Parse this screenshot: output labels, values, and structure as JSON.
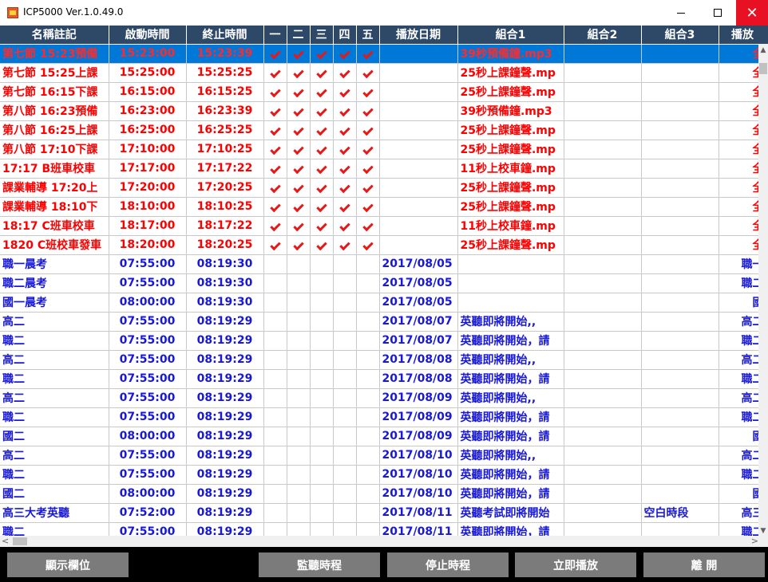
{
  "window": {
    "title": "ICP5000 Ver.1.0.49.0",
    "minimize": "—",
    "maximize": "□",
    "close": "✕"
  },
  "columns": [
    "名稱註記",
    "啟動時間",
    "終止時間",
    "一",
    "二",
    "三",
    "四",
    "五",
    "播放日期",
    "組合1",
    "組合2",
    "組合3",
    "播放"
  ],
  "rows": [
    {
      "name": "第七節 15:23預備",
      "start": "15:23:00",
      "end": "15:23:39",
      "days": [
        true,
        true,
        true,
        true,
        true
      ],
      "date": "",
      "combo1": "39秒預備鐘.mp3",
      "combo2": "",
      "combo3": "",
      "play": "全",
      "color": "red",
      "selected": true
    },
    {
      "name": "第七節 15:25上課",
      "start": "15:25:00",
      "end": "15:25:25",
      "days": [
        true,
        true,
        true,
        true,
        true
      ],
      "date": "",
      "combo1": "25秒上課鐘聲.mp",
      "combo2": "",
      "combo3": "",
      "play": "全",
      "color": "red",
      "selected": false
    },
    {
      "name": "第七節 16:15下課",
      "start": "16:15:00",
      "end": "16:15:25",
      "days": [
        true,
        true,
        true,
        true,
        true
      ],
      "date": "",
      "combo1": "25秒上課鐘聲.mp",
      "combo2": "",
      "combo3": "",
      "play": "全",
      "color": "red",
      "selected": false
    },
    {
      "name": "第八節 16:23預備",
      "start": "16:23:00",
      "end": "16:23:39",
      "days": [
        true,
        true,
        true,
        true,
        true
      ],
      "date": "",
      "combo1": "39秒預備鐘.mp3",
      "combo2": "",
      "combo3": "",
      "play": "全",
      "color": "red",
      "selected": false
    },
    {
      "name": "第八節 16:25上課",
      "start": "16:25:00",
      "end": "16:25:25",
      "days": [
        true,
        true,
        true,
        true,
        true
      ],
      "date": "",
      "combo1": "25秒上課鐘聲.mp",
      "combo2": "",
      "combo3": "",
      "play": "全",
      "color": "red",
      "selected": false
    },
    {
      "name": "第八節 17:10下課",
      "start": "17:10:00",
      "end": "17:10:25",
      "days": [
        true,
        true,
        true,
        true,
        true
      ],
      "date": "",
      "combo1": "25秒上課鐘聲.mp",
      "combo2": "",
      "combo3": "",
      "play": "全",
      "color": "red",
      "selected": false
    },
    {
      "name": "17:17 B班車校車",
      "start": "17:17:00",
      "end": "17:17:22",
      "days": [
        true,
        true,
        true,
        true,
        true
      ],
      "date": "",
      "combo1": "11秒上校車鐘.mp",
      "combo2": "",
      "combo3": "",
      "play": "全",
      "color": "red",
      "selected": false
    },
    {
      "name": "課業輔導 17:20上",
      "start": "17:20:00",
      "end": "17:20:25",
      "days": [
        true,
        true,
        true,
        true,
        true
      ],
      "date": "",
      "combo1": "25秒上課鐘聲.mp",
      "combo2": "",
      "combo3": "",
      "play": "全",
      "color": "red",
      "selected": false
    },
    {
      "name": "課業輔導 18:10下",
      "start": "18:10:00",
      "end": "18:10:25",
      "days": [
        true,
        true,
        true,
        true,
        true
      ],
      "date": "",
      "combo1": "25秒上課鐘聲.mp",
      "combo2": "",
      "combo3": "",
      "play": "全",
      "color": "red",
      "selected": false
    },
    {
      "name": "18:17 C班車校車",
      "start": "18:17:00",
      "end": "18:17:22",
      "days": [
        true,
        true,
        true,
        true,
        true
      ],
      "date": "",
      "combo1": "11秒上校車鐘.mp",
      "combo2": "",
      "combo3": "",
      "play": "全",
      "color": "red",
      "selected": false
    },
    {
      "name": "1820 C班校車發車",
      "start": "18:20:00",
      "end": "18:20:25",
      "days": [
        true,
        true,
        true,
        true,
        true
      ],
      "date": "",
      "combo1": "25秒上課鐘聲.mp",
      "combo2": "",
      "combo3": "",
      "play": "全",
      "color": "red",
      "selected": false
    },
    {
      "name": "職一晨考",
      "start": "07:55:00",
      "end": "08:19:30",
      "days": [
        false,
        false,
        false,
        false,
        false
      ],
      "date": "2017/08/05",
      "combo1": "",
      "combo2": "",
      "combo3": "",
      "play": "職一",
      "color": "blue",
      "selected": false
    },
    {
      "name": "職二晨考",
      "start": "07:55:00",
      "end": "08:19:30",
      "days": [
        false,
        false,
        false,
        false,
        false
      ],
      "date": "2017/08/05",
      "combo1": "",
      "combo2": "",
      "combo3": "",
      "play": "職二",
      "color": "blue",
      "selected": false
    },
    {
      "name": "國一晨考",
      "start": "08:00:00",
      "end": "08:19:30",
      "days": [
        false,
        false,
        false,
        false,
        false
      ],
      "date": "2017/08/05",
      "combo1": "",
      "combo2": "",
      "combo3": "",
      "play": "國",
      "color": "blue",
      "selected": false
    },
    {
      "name": "高二",
      "start": "07:55:00",
      "end": "08:19:29",
      "days": [
        false,
        false,
        false,
        false,
        false
      ],
      "date": "2017/08/07",
      "combo1": "英聽即將開始,,",
      "combo2": "",
      "combo3": "",
      "play": "高二",
      "color": "blue",
      "selected": false
    },
    {
      "name": "職二",
      "start": "07:55:00",
      "end": "08:19:29",
      "days": [
        false,
        false,
        false,
        false,
        false
      ],
      "date": "2017/08/07",
      "combo1": "英聽即將開始，請",
      "combo2": "",
      "combo3": "",
      "play": "職二",
      "color": "blue",
      "selected": false
    },
    {
      "name": "高二",
      "start": "07:55:00",
      "end": "08:19:29",
      "days": [
        false,
        false,
        false,
        false,
        false
      ],
      "date": "2017/08/08",
      "combo1": "英聽即將開始,,",
      "combo2": "",
      "combo3": "",
      "play": "高二",
      "color": "blue",
      "selected": false
    },
    {
      "name": "職二",
      "start": "07:55:00",
      "end": "08:19:29",
      "days": [
        false,
        false,
        false,
        false,
        false
      ],
      "date": "2017/08/08",
      "combo1": "英聽即將開始，請",
      "combo2": "",
      "combo3": "",
      "play": "職二",
      "color": "blue",
      "selected": false
    },
    {
      "name": "高二",
      "start": "07:55:00",
      "end": "08:19:29",
      "days": [
        false,
        false,
        false,
        false,
        false
      ],
      "date": "2017/08/09",
      "combo1": "英聽即將開始,,",
      "combo2": "",
      "combo3": "",
      "play": "高二",
      "color": "blue",
      "selected": false
    },
    {
      "name": "職二",
      "start": "07:55:00",
      "end": "08:19:29",
      "days": [
        false,
        false,
        false,
        false,
        false
      ],
      "date": "2017/08/09",
      "combo1": "英聽即將開始，請",
      "combo2": "",
      "combo3": "",
      "play": "職二",
      "color": "blue",
      "selected": false
    },
    {
      "name": "國二",
      "start": "08:00:00",
      "end": "08:19:29",
      "days": [
        false,
        false,
        false,
        false,
        false
      ],
      "date": "2017/08/09",
      "combo1": "英聽即將開始，請",
      "combo2": "",
      "combo3": "",
      "play": "國",
      "color": "blue",
      "selected": false
    },
    {
      "name": "高二",
      "start": "07:55:00",
      "end": "08:19:29",
      "days": [
        false,
        false,
        false,
        false,
        false
      ],
      "date": "2017/08/10",
      "combo1": "英聽即將開始,,",
      "combo2": "",
      "combo3": "",
      "play": "高二",
      "color": "blue",
      "selected": false
    },
    {
      "name": "職二",
      "start": "07:55:00",
      "end": "08:19:29",
      "days": [
        false,
        false,
        false,
        false,
        false
      ],
      "date": "2017/08/10",
      "combo1": "英聽即將開始，請",
      "combo2": "",
      "combo3": "",
      "play": "職二",
      "color": "blue",
      "selected": false
    },
    {
      "name": "國二",
      "start": "08:00:00",
      "end": "08:19:29",
      "days": [
        false,
        false,
        false,
        false,
        false
      ],
      "date": "2017/08/10",
      "combo1": "英聽即將開始，請",
      "combo2": "",
      "combo3": "",
      "play": "國",
      "color": "blue",
      "selected": false
    },
    {
      "name": "高三大考英聽",
      "start": "07:52:00",
      "end": "08:19:29",
      "days": [
        false,
        false,
        false,
        false,
        false
      ],
      "date": "2017/08/11",
      "combo1": "英聽考試即將開始",
      "combo2": "",
      "combo3": "空白時段",
      "play": "高三",
      "color": "blue",
      "selected": false
    },
    {
      "name": "職二",
      "start": "07:55:00",
      "end": "08:19:29",
      "days": [
        false,
        false,
        false,
        false,
        false
      ],
      "date": "2017/08/11",
      "combo1": "英聽即將開始，請",
      "combo2": "",
      "combo3": "",
      "play": "職二",
      "color": "blue",
      "selected": false
    }
  ],
  "scrollbar": {
    "up": "▲",
    "down": "▼",
    "left": "<",
    "right": ">"
  },
  "toolbar": {
    "show_columns": "顯示欄位",
    "monitor_schedule": "監聽時程",
    "stop_schedule": "停止時程",
    "play_now": "立即播放",
    "exit": "離 開"
  },
  "colors": {
    "header_bg": "#2e4868",
    "selected_bg": "#0078d7",
    "red_text": "#ff0000",
    "blue_text": "#1818d8",
    "close_btn": "#e81123",
    "toolbar_btn": "#7b7b7b"
  }
}
